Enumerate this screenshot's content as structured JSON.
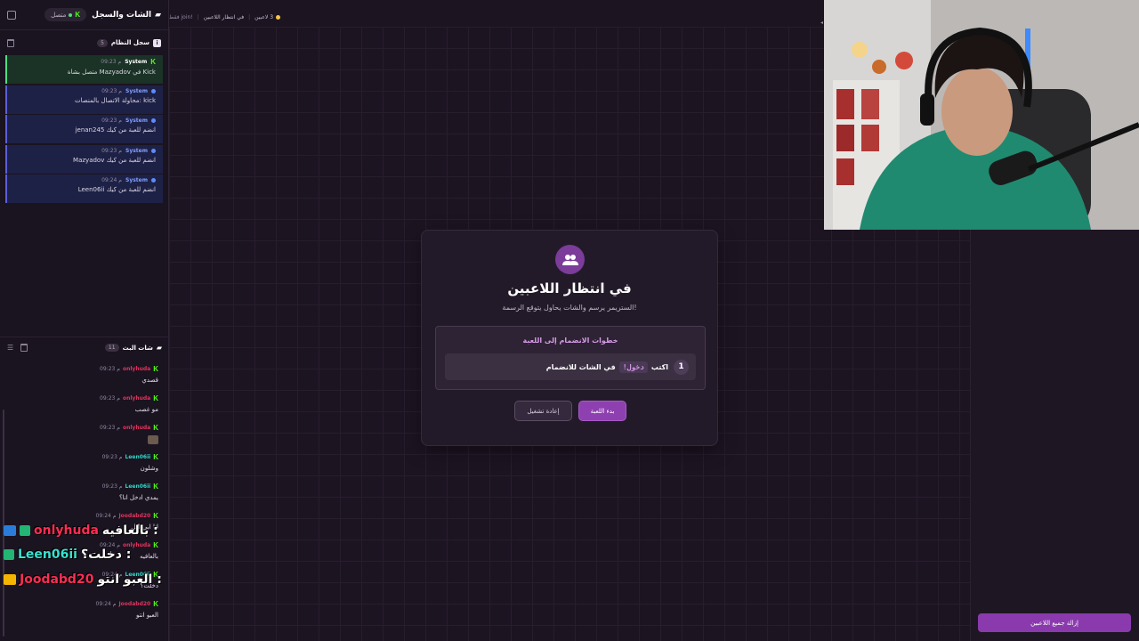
{
  "left_panel": {
    "title": "الشات والسجل",
    "status": "متصل",
    "system_log": {
      "title": "سجل النظام",
      "count": "5",
      "items": [
        {
          "who": "System",
          "time": "09:23 م",
          "text": "متصل بشاة Mazyadov في Kick"
        },
        {
          "who": "System",
          "time": "09:23 م",
          "text": "محاولة الاتصال بالمنصات: kick"
        },
        {
          "who": "System",
          "time": "09:23 م",
          "text": "jenan245 انضم للعبة من كيك"
        },
        {
          "who": "System",
          "time": "09:23 م",
          "text": "Mazyadov انضم للعبة من كيك"
        },
        {
          "who": "System",
          "time": "09:24 م",
          "text": "Leen06ii انضم للعبة من كيك"
        }
      ]
    },
    "live_chat": {
      "title": "شات البث",
      "count": "11",
      "messages": [
        {
          "user": "onlyhuda",
          "time": "09:23 م",
          "text": "قصدي",
          "color": "#e0345c"
        },
        {
          "user": "onlyhuda",
          "time": "09:23 م",
          "text": "مو غصب",
          "color": "#e0345c"
        },
        {
          "user": "onlyhuda",
          "time": "09:23 م",
          "text": "",
          "color": "#e0345c"
        },
        {
          "user": "Leen06ii",
          "time": "09:23 م",
          "text": "وشلون",
          "color": "#2fd6c8"
        },
        {
          "user": "Leen06ii",
          "time": "09:23 م",
          "text": "يمدي ادخل انا؟",
          "color": "#2fd6c8"
        },
        {
          "user": "Joodabd20",
          "time": "09:24 م",
          "text": "انا ابي اكل",
          "color": "#e0345c"
        },
        {
          "user": "onlyhuda",
          "time": "09:24 م",
          "text": "بالعافيه",
          "color": "#e0345c"
        },
        {
          "user": "Leen06ii",
          "time": "09:24 م",
          "text": "دخلت؟",
          "color": "#2fd6c8"
        },
        {
          "user": "Joodabd20",
          "time": "09:24 م",
          "text": "العبو انتو",
          "color": "#e0345c"
        }
      ]
    }
  },
  "overlay_names": [
    {
      "name": "onlyhuda",
      "msg": "بالعافيه :",
      "color": "#ff2d55",
      "badge": "#2b7cd9"
    },
    {
      "name": "Leen06ii",
      "msg": "دخلت؟ :",
      "color": "#3be0d0",
      "badge": "#22b573"
    },
    {
      "name": "Joodabd20",
      "msg": "العبو انتو :",
      "color": "#ff2d55",
      "badge": "#f5b400"
    }
  ],
  "topbar": {
    "players": "3 لاعبين",
    "status": "في انتظار اللاعبين",
    "join_hint": "!join فقط"
  },
  "card": {
    "title": "في انتظار اللاعبين",
    "subtitle": "الستريمر يرسم والشات يحاول يتوقع الرسمة!",
    "steps_title": "خطوات الانضمام إلى اللعبة",
    "step_number": "1",
    "step_write": "اكتب",
    "step_keyword": "!دخول",
    "step_rest": "في الشات للانضمام",
    "start_button": "بدء اللعبة",
    "restart_button": "إعادة تشغيل"
  },
  "right_panel": {
    "remove_all_button": "إزالة جميع اللاعبين"
  },
  "colors": {
    "accent": "#8e3fb0",
    "kick_green": "#53fc18",
    "background": "#1d1422"
  }
}
